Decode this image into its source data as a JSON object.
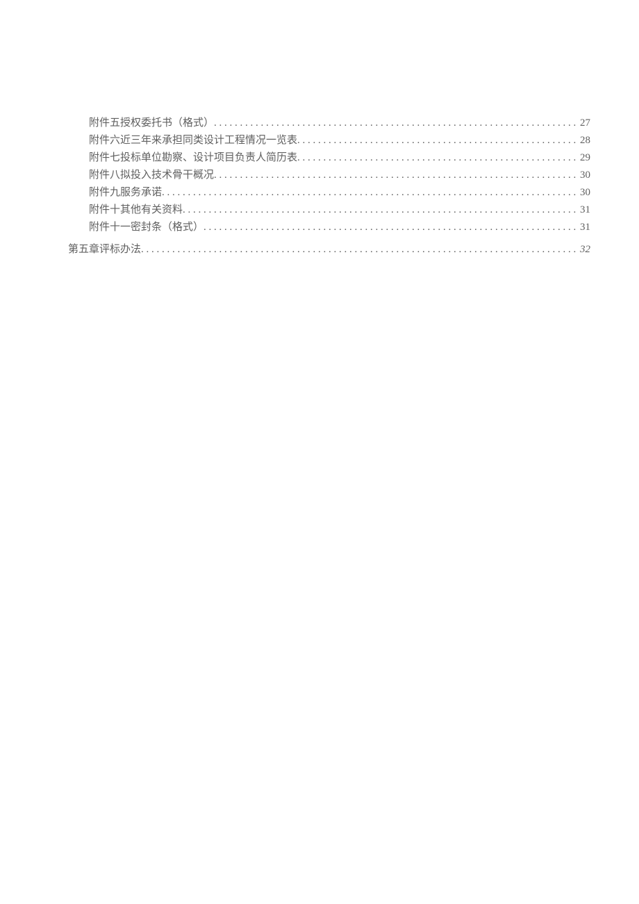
{
  "toc": {
    "sub_items": [
      {
        "title": "附件五授权委托书（格式）",
        "page": "27"
      },
      {
        "title": "附件六近三年来承担同类设计工程情况一览表",
        "page": "28"
      },
      {
        "title": "附件七投标单位勘察、设计项目负责人简历表",
        "page": "29"
      },
      {
        "title": "附件八拟投入技术骨干概况",
        "page": "30"
      },
      {
        "title": "附件九服务承诺",
        "page": "30"
      },
      {
        "title": "附件十其他有关资料",
        "page": "31"
      },
      {
        "title": "附件十一密封条（格式）",
        "page": "31"
      }
    ],
    "chapter": {
      "title": "第五章评标办法",
      "page": "32"
    }
  }
}
